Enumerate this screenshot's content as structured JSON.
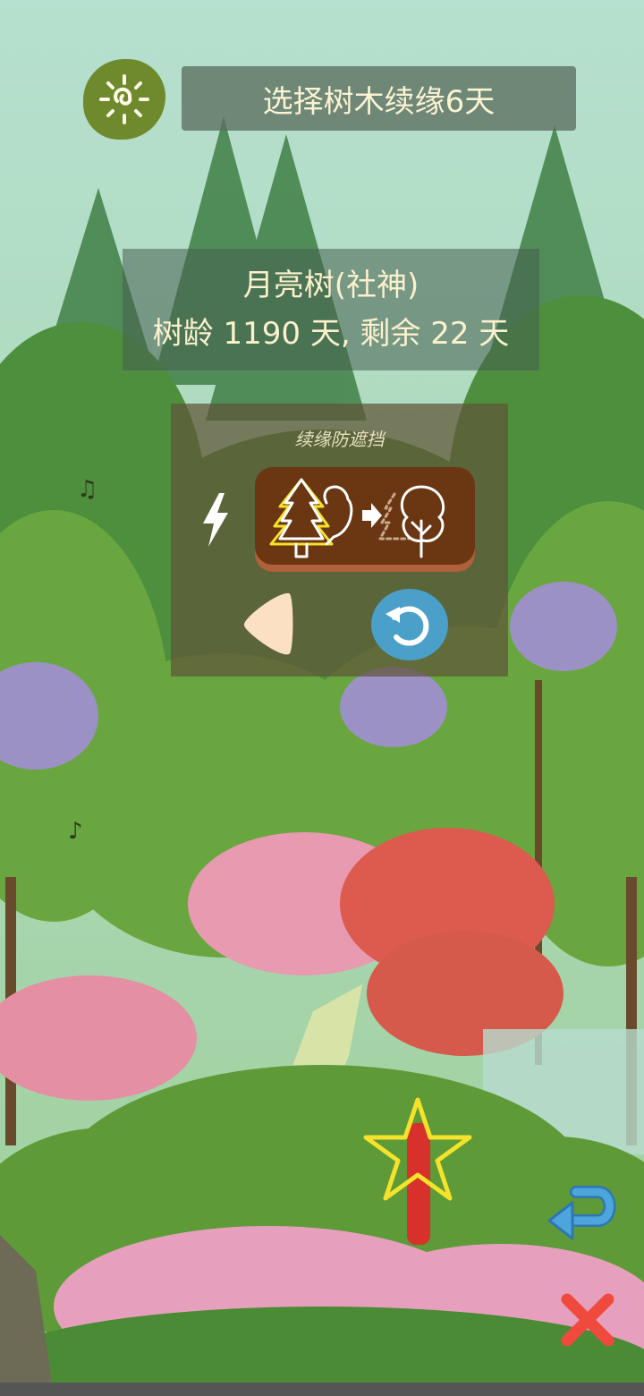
{
  "header": {
    "banner_text": "选择树木续缘6天",
    "menu_icon": "swirl-sun-icon"
  },
  "tree_info": {
    "name": "月亮树(社神)",
    "age_line": "树龄 1190 天, 剩余 22 天"
  },
  "panel": {
    "title": "续缘防遮挡",
    "lightning_icon": "lightning-icon",
    "tree_toggle_icon": "conifer-to-broadleaf-icon",
    "back_icon": "triangle-left-icon",
    "refresh_icon": "refresh-icon"
  },
  "controls": {
    "star_icon": "star-marker-icon",
    "undo_icon": "undo-arrow-icon",
    "close_icon": "close-x-icon"
  },
  "colors": {
    "sky": "#b6e0cf",
    "banner_text": "#fbf3d2",
    "menu_green": "#6e8a2d",
    "toggle_brown": "#6b3612",
    "refresh_blue": "#4aa0c8",
    "close_red": "#f04a3e",
    "undo_blue": "#4da5dc",
    "star_yellow": "#f5e22b"
  }
}
